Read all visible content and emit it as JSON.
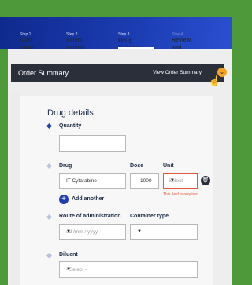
{
  "stepper": {
    "steps": [
      {
        "num": "Step 1",
        "label": "Start Order"
      },
      {
        "num": "Step 2",
        "label": "Select Patient"
      },
      {
        "num": "Step 3",
        "label": "Drug Details"
      },
      {
        "num": "Step 4",
        "label": "Review and Complete"
      }
    ]
  },
  "summary": {
    "title": "Order Summary",
    "link": "View Order Summary",
    "toggle_icon": "chevron-down"
  },
  "form": {
    "title": "Drug details",
    "quantity": {
      "label": "Quantity",
      "value": ""
    },
    "drug": {
      "label": "Drug",
      "value": "IT Cytarabine"
    },
    "dose": {
      "label": "Dose",
      "value": "1000"
    },
    "unit": {
      "label": "Unit",
      "value": "Select",
      "error": "This field is required"
    },
    "add_another": "Add another",
    "route": {
      "label": "Route of administration",
      "placeholder": "dd /mm / yyyy"
    },
    "container": {
      "label": "Container type",
      "value": ""
    },
    "diluent": {
      "label": "Diluent",
      "placeholder": "- Select -"
    }
  },
  "colors": {
    "accent": "#1e3fae",
    "error": "#e2573a",
    "summary_bar": "#2b2f3a",
    "toggle": "#f5a524"
  }
}
